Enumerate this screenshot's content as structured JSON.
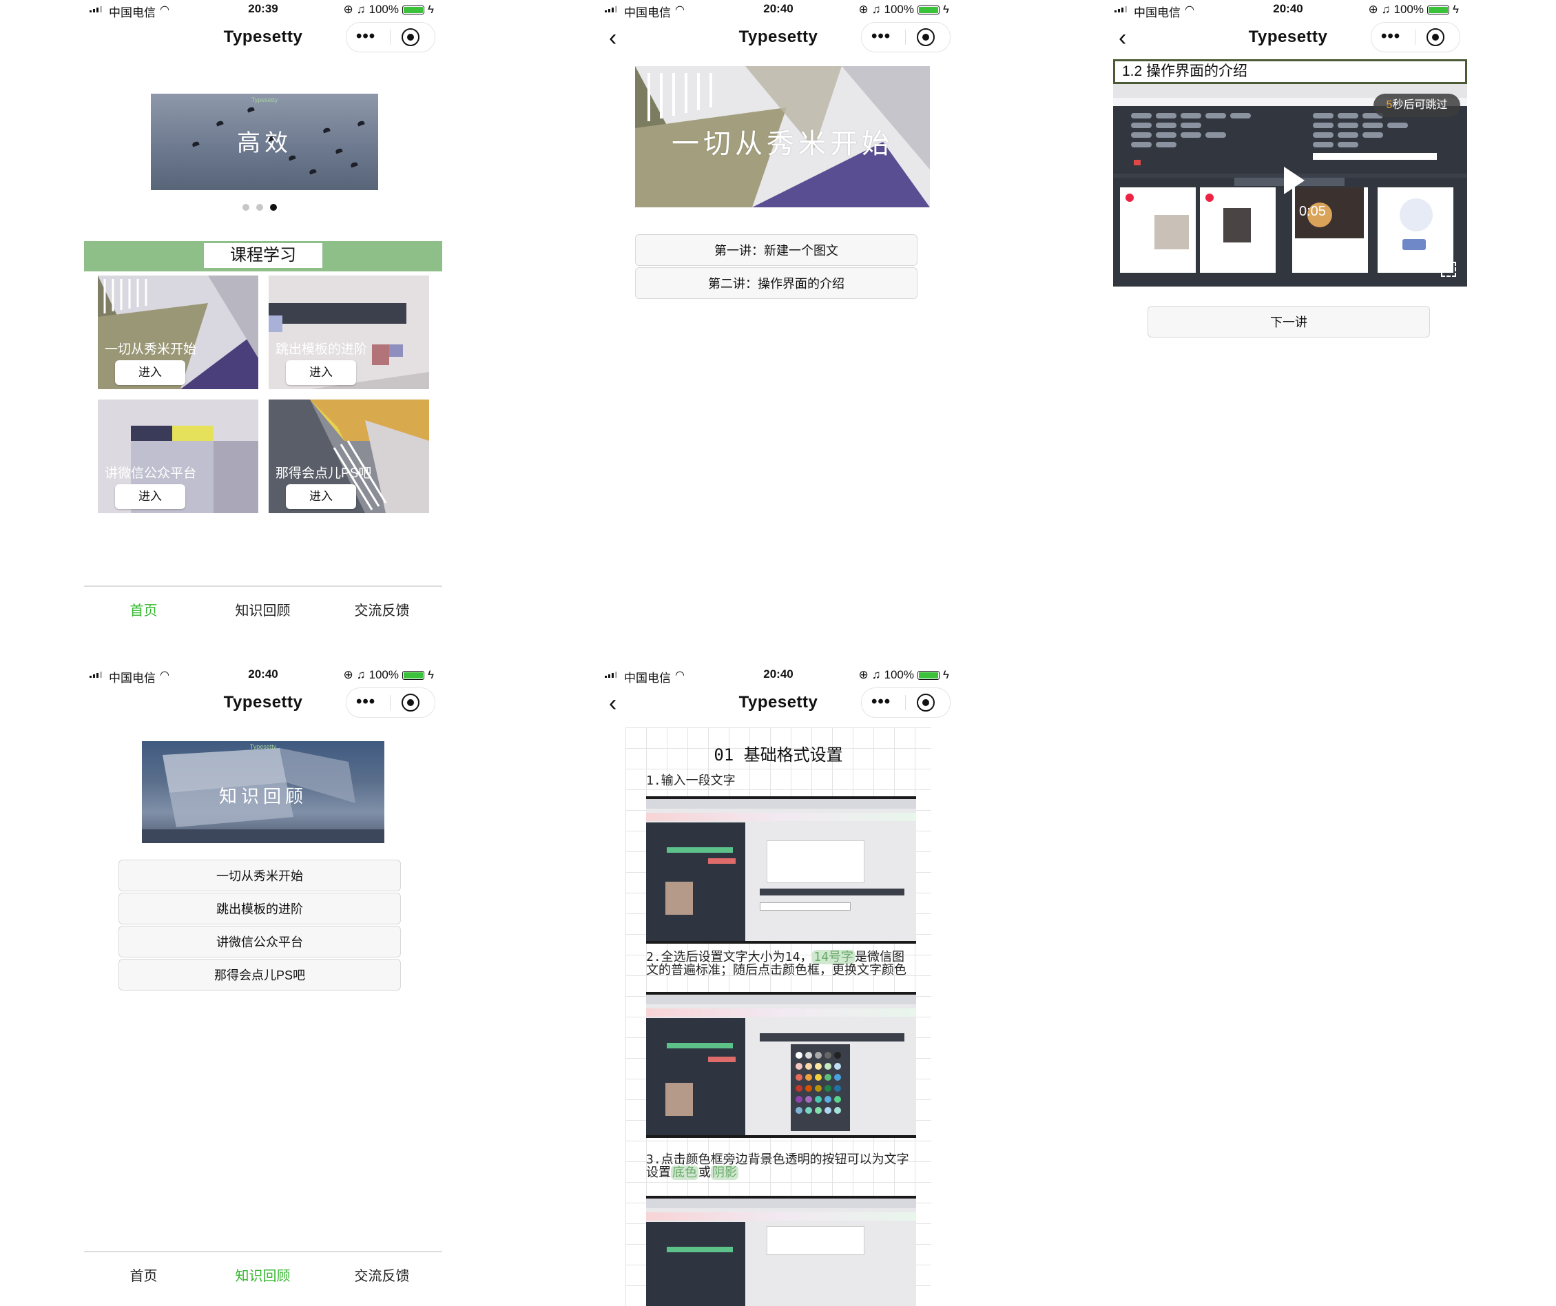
{
  "status": {
    "carrier": "中国电信",
    "battery": "100%",
    "times": [
      "20:39",
      "20:40",
      "20:40",
      "20:40",
      "20:40"
    ]
  },
  "app": {
    "title": "Typesetty",
    "more_icon": "•••"
  },
  "home": {
    "banner_caption": "高效",
    "banner_brand": "Typesetty",
    "section_label": "课程学习",
    "cards": [
      {
        "title": "一切从秀米开始",
        "button": "进入"
      },
      {
        "title": "跳出模板的进阶",
        "button": "进入"
      },
      {
        "title": "讲微信公众平台",
        "button": "进入"
      },
      {
        "title": "那得会点儿PS吧",
        "button": "进入"
      }
    ]
  },
  "tabbar": {
    "tabs": [
      "首页",
      "知识回顾",
      "交流反馈"
    ]
  },
  "course": {
    "banner_caption": "一切从秀米开始",
    "lessons": [
      "第一讲：新建一个图文",
      "第二讲：操作界面的介绍"
    ]
  },
  "video": {
    "title": "1.2 操作界面的介绍",
    "skip_count": "5",
    "skip_text": "秒后可跳过",
    "time": "0:05",
    "next_label": "下一讲"
  },
  "review": {
    "banner_caption": "知识回顾",
    "banner_brand": "Typesetty",
    "items": [
      "一切从秀米开始",
      "跳出模板的进阶",
      "讲微信公众平台",
      "那得会点儿PS吧"
    ]
  },
  "article": {
    "heading": "01 基础格式设置",
    "step1": "1.输入一段文字",
    "step2_a": "2.全选后设置文字大小为14，",
    "step2_hl": "14号字",
    "step2_b": "是微信图文的普遍标准；随后点击颜色框，更换文字颜色",
    "step3_a": "3.点击颜色框旁边背景色透明的按钮可以为文字设置",
    "step3_hl1": "底色",
    "step3_mid": "或",
    "step3_hl2": "阴影"
  },
  "colors": {
    "accent": "#35b72f",
    "section_bar": "#8fbf89",
    "battery": "#3cc13b"
  }
}
